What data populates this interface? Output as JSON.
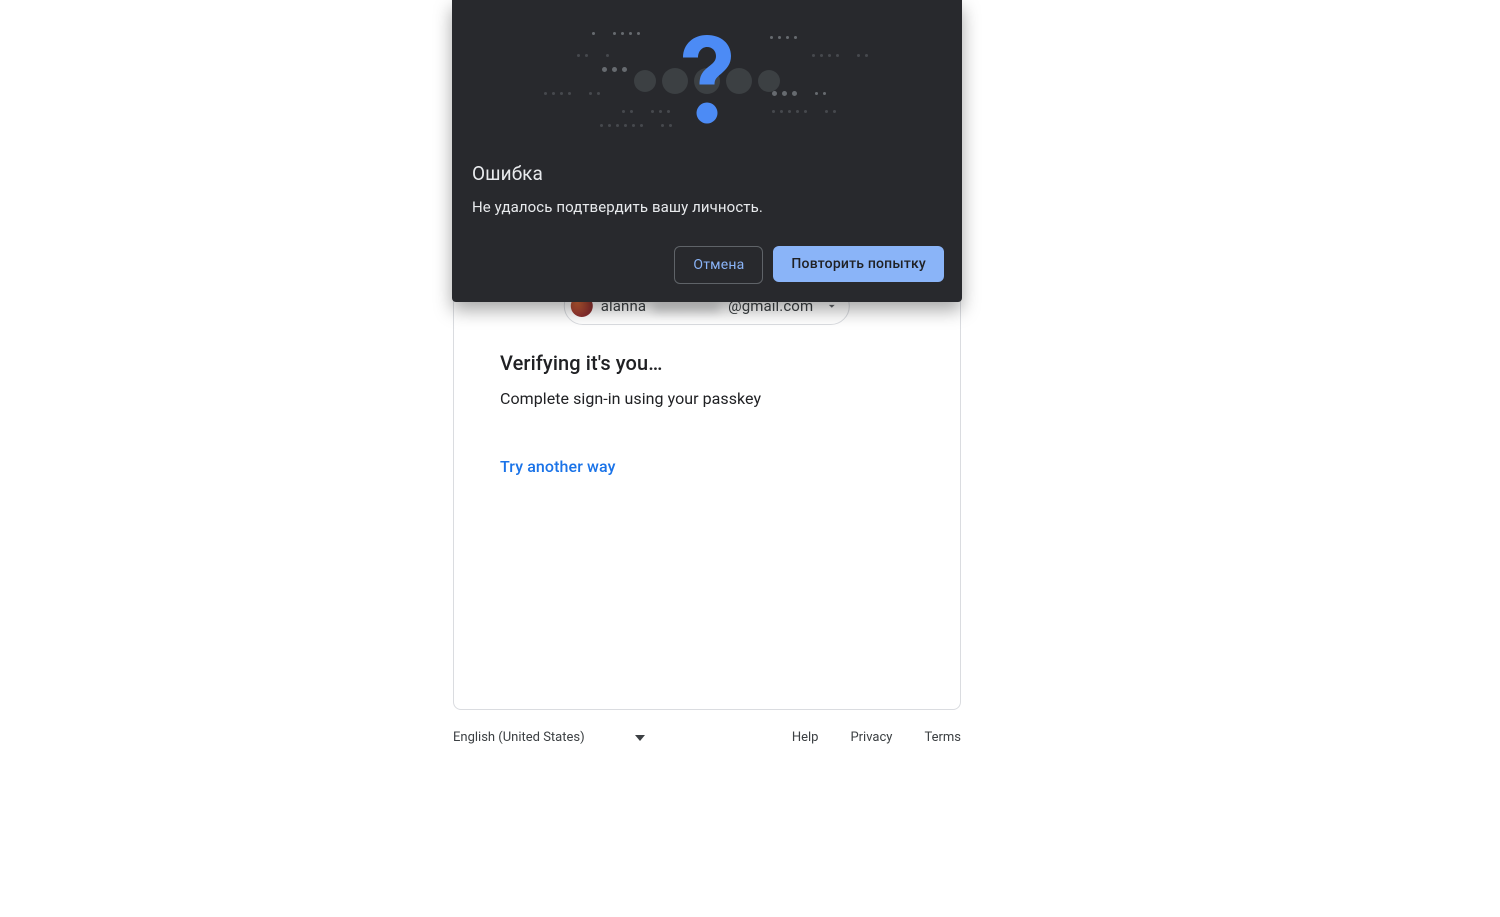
{
  "dialog": {
    "title": "Ошибка",
    "message": "Не удалось подтвердить вашу личность.",
    "cancel": "Отмена",
    "retry": "Повторить попытку"
  },
  "signin": {
    "account": {
      "email_visible_start": "alanna",
      "email_redacted_middle": "xxxxxxx",
      "email_visible_end": "@gmail.com"
    },
    "verify_title": "Verifying it's you…",
    "verify_sub": "Complete sign-in using your passkey",
    "try_another": "Try another way"
  },
  "footer": {
    "language": "English (United States)",
    "links": {
      "help": "Help",
      "privacy": "Privacy",
      "terms": "Terms"
    }
  }
}
